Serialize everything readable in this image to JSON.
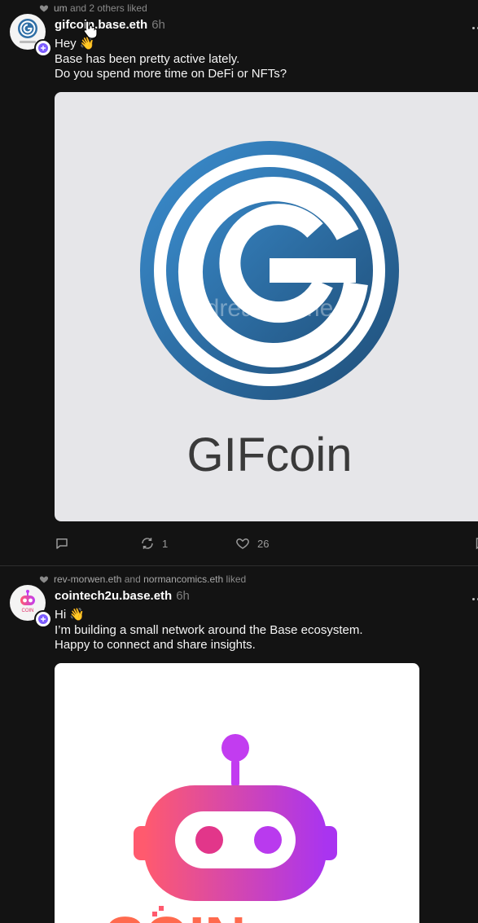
{
  "posts": [
    {
      "liked_by_text": "um and 2 others liked",
      "liked_by_names": "um",
      "liked_by_rest": "and 2 others liked",
      "username": "gifcoin.base.eth",
      "time": "6h",
      "lines": [
        "Hey 👋",
        "Base has been pretty active lately.",
        "Do you spend more time on DeFi or NFTs?"
      ],
      "image": {
        "brand_text": "GIFcoin",
        "watermark": "dreamstime"
      },
      "actions": {
        "replies": "",
        "recasts": "1",
        "likes": "26"
      }
    },
    {
      "liked_by_a": "rev-morwen.eth",
      "liked_by_and": "and",
      "liked_by_b": "normancomics.eth",
      "liked_by_suffix": "liked",
      "username": "cointech2u.base.eth",
      "time": "6h",
      "lines": [
        "Hi 👋",
        "I’m building a small network around the Base ecosystem.",
        "Happy to connect and share insights."
      ],
      "image": {
        "brand_text": "COIN"
      }
    }
  ],
  "colors": {
    "background": "#131313",
    "gifcoin_blue": "#2f6fa6",
    "robot_gradient": [
      "#ff5a6e",
      "#c23cf0"
    ],
    "add_badge": "#7c5cff"
  },
  "icons": [
    "heart-icon",
    "reply-icon",
    "recast-icon",
    "like-icon",
    "plus-icon",
    "more-icon",
    "bookmark-icon"
  ]
}
